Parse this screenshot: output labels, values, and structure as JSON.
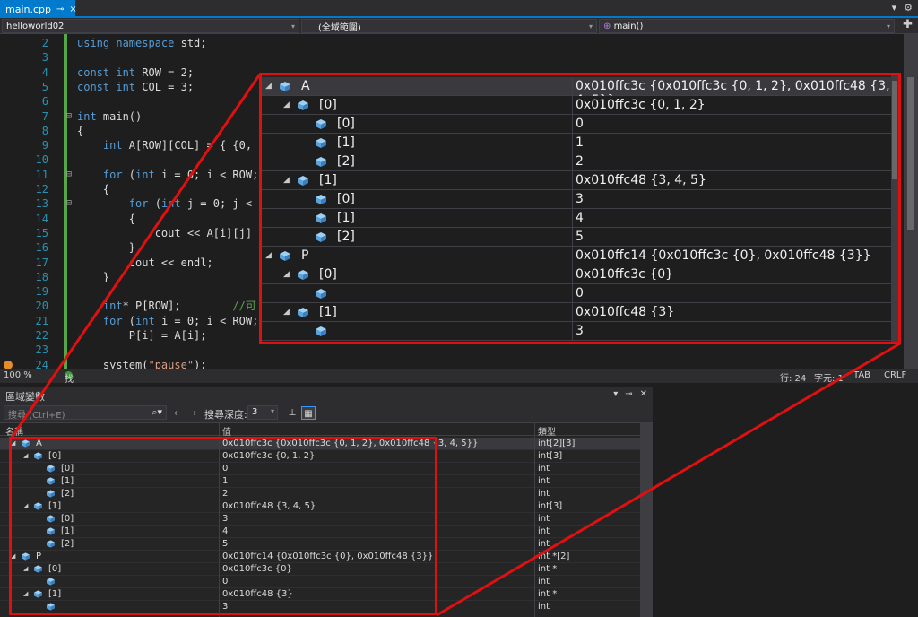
{
  "tab": {
    "file": "main.cpp",
    "pin": "⊸",
    "close": "×"
  },
  "nav": {
    "project": "helloworld02",
    "scope": "(全域範圍)",
    "func": "main()"
  },
  "code_lines": [
    {
      "n": "2",
      "parts": [
        [
          "kw",
          "using namespace "
        ],
        [
          "",
          "std;"
        ]
      ]
    },
    {
      "n": "3",
      "parts": []
    },
    {
      "n": "4",
      "parts": [
        [
          "kw",
          "const int "
        ],
        [
          "",
          "ROW = 2;"
        ]
      ]
    },
    {
      "n": "5",
      "parts": [
        [
          "kw",
          "const int "
        ],
        [
          "",
          "COL = 3;"
        ]
      ]
    },
    {
      "n": "6",
      "parts": []
    },
    {
      "n": "7",
      "parts": [
        [
          "kw",
          "int "
        ],
        [
          "",
          "main()"
        ]
      ]
    },
    {
      "n": "8",
      "parts": [
        [
          "",
          "{"
        ]
      ]
    },
    {
      "n": "9",
      "parts": [
        [
          "kw",
          "    int "
        ],
        [
          "",
          "A[ROW][COL] = { {0,"
        ]
      ]
    },
    {
      "n": "10",
      "parts": []
    },
    {
      "n": "11",
      "parts": [
        [
          "kw",
          "    for "
        ],
        [
          "",
          "("
        ],
        [
          "kw",
          "int "
        ],
        [
          "",
          "i = 0; i < ROW;"
        ]
      ]
    },
    {
      "n": "12",
      "parts": [
        [
          "",
          "    {"
        ]
      ]
    },
    {
      "n": "13",
      "parts": [
        [
          "kw",
          "        for "
        ],
        [
          "",
          "("
        ],
        [
          "kw",
          "int "
        ],
        [
          "",
          "j = 0; j <"
        ]
      ]
    },
    {
      "n": "14",
      "parts": [
        [
          "",
          "        {"
        ]
      ]
    },
    {
      "n": "15",
      "parts": [
        [
          "",
          "            cout << A[i][j]"
        ]
      ]
    },
    {
      "n": "16",
      "parts": [
        [
          "",
          "        }"
        ]
      ]
    },
    {
      "n": "17",
      "parts": [
        [
          "",
          "        cout << endl;"
        ]
      ]
    },
    {
      "n": "18",
      "parts": [
        [
          "",
          "    }"
        ]
      ]
    },
    {
      "n": "19",
      "parts": []
    },
    {
      "n": "20",
      "parts": [
        [
          "kw",
          "    int"
        ],
        [
          "",
          "* P[ROW];        "
        ],
        [
          "cm",
          "//可"
        ]
      ]
    },
    {
      "n": "21",
      "parts": [
        [
          "kw",
          "    for "
        ],
        [
          "",
          "("
        ],
        [
          "kw",
          "int "
        ],
        [
          "",
          "i = 0; i < ROW;"
        ]
      ]
    },
    {
      "n": "22",
      "parts": [
        [
          "",
          "        P[i] = A[i];"
        ]
      ]
    },
    {
      "n": "23",
      "parts": []
    },
    {
      "n": "24",
      "parts": [
        [
          "",
          "    system("
        ],
        [
          "str",
          "\"pause\""
        ],
        [
          "",
          ");"
        ]
      ]
    }
  ],
  "status": {
    "zoom": "100 %",
    "issues": "找不到任何問題",
    "line": "行: 24",
    "char": "字元: 1",
    "tab": "TAB",
    "eol": "CRLF"
  },
  "locals": {
    "title": "區域變數",
    "search_placeholder": "搜尋 (Ctrl+E)",
    "depth_label": "搜尋深度:",
    "depth_value": "3",
    "columns": {
      "name": "名稱",
      "value": "值",
      "type": "類型"
    }
  },
  "rows": [
    {
      "level": 0,
      "expand": true,
      "name": "A",
      "value": "0x010ffc3c {0x010ffc3c {0, 1, 2}, 0x010ffc48 {3, 4, 5}}",
      "type": "int[2][3]",
      "sel": true
    },
    {
      "level": 1,
      "expand": true,
      "name": "[0]",
      "value": "0x010ffc3c {0, 1, 2}",
      "type": "int[3]"
    },
    {
      "level": 2,
      "expand": false,
      "name": "[0]",
      "value": "0",
      "type": "int"
    },
    {
      "level": 2,
      "expand": false,
      "name": "[1]",
      "value": "1",
      "type": "int"
    },
    {
      "level": 2,
      "expand": false,
      "name": "[2]",
      "value": "2",
      "type": "int"
    },
    {
      "level": 1,
      "expand": true,
      "name": "[1]",
      "value": "0x010ffc48 {3, 4, 5}",
      "type": "int[3]"
    },
    {
      "level": 2,
      "expand": false,
      "name": "[0]",
      "value": "3",
      "type": "int"
    },
    {
      "level": 2,
      "expand": false,
      "name": "[1]",
      "value": "4",
      "type": "int"
    },
    {
      "level": 2,
      "expand": false,
      "name": "[2]",
      "value": "5",
      "type": "int"
    },
    {
      "level": 0,
      "expand": true,
      "name": "P",
      "value": "0x010ffc14 {0x010ffc3c {0}, 0x010ffc48 {3}}",
      "type": "int *[2]"
    },
    {
      "level": 1,
      "expand": true,
      "name": "[0]",
      "value": "0x010ffc3c {0}",
      "type": "int *"
    },
    {
      "level": 2,
      "expand": false,
      "name": "",
      "value": "0",
      "type": "int"
    },
    {
      "level": 1,
      "expand": true,
      "name": "[1]",
      "value": "0x010ffc48 {3}",
      "type": "int *"
    },
    {
      "level": 2,
      "expand": false,
      "name": "",
      "value": "3",
      "type": "int"
    }
  ],
  "colors": {
    "accent": "#007acc",
    "highlight": "#e01010",
    "cube": "#5ba3dc"
  }
}
